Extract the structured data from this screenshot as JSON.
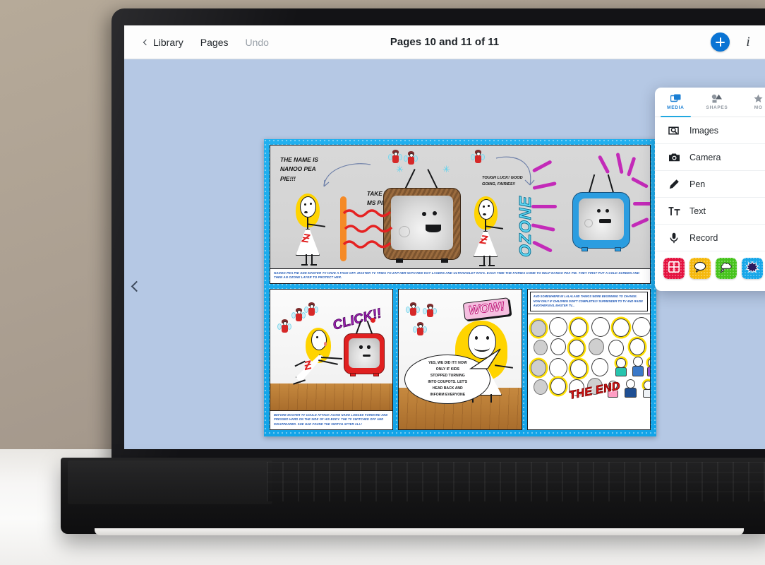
{
  "app": {
    "toolbar": {
      "back_label": "Library",
      "pages_label": "Pages",
      "undo_label": "Undo",
      "title": "Pages 10 and 11 of 11",
      "add_icon": "plus-icon",
      "info_icon": "info-icon"
    },
    "canvas": {
      "prev_page_icon": "chevron-left-icon",
      "background_color": "#b5c8e4"
    },
    "tool_panel": {
      "tabs": [
        {
          "label": "MEDIA",
          "icon": "media-icon",
          "active": true
        },
        {
          "label": "SHAPES",
          "icon": "shapes-icon",
          "active": false
        },
        {
          "label": "MO",
          "icon": "more-icon",
          "active": false
        }
      ],
      "items": [
        {
          "label": "Images",
          "icon": "image-search-icon"
        },
        {
          "label": "Camera",
          "icon": "camera-icon"
        },
        {
          "label": "Pen",
          "icon": "pen-icon"
        },
        {
          "label": "Text",
          "icon": "text-icon"
        },
        {
          "label": "Record",
          "icon": "microphone-icon"
        }
      ],
      "swatches": [
        {
          "name": "layout-grid-swatch",
          "color": "#e4123f",
          "icon": "grid-panels-icon"
        },
        {
          "name": "speech-bubble-swatch",
          "color": "#f5b80c",
          "icon": "speech-bubble-icon"
        },
        {
          "name": "thought-cloud-swatch",
          "color": "#46c31c",
          "icon": "thought-cloud-icon"
        },
        {
          "name": "burst-swatch",
          "color": "#16a6e8",
          "icon": "burst-pow-icon"
        }
      ]
    }
  },
  "comic": {
    "border_color": "#15a8ea",
    "panels": {
      "top": {
        "speech_1": "THE NAME IS\nNANOO PEA\nPIE!!!",
        "speech_2": "TAKE THAT,\nMS PIE!",
        "speech_3": "TOUGH LUCK! GOOD\nGOING, FAIRIES!!",
        "word_art": "OZONE",
        "caption": "NANOO PEA PIE AND MASTER TV HAVE A FACE OFF. MASTER TV TRIES TO ZAP HER WITH RED HOT LASERS AND ULTRAVIOLET RAYS. EACH TIME THE FAIRIES COME TO HELP NANOO PEA PIE. THEY FIRST PUT A COLD SCREEN AND THEN AN OZONE LAYER TO PROTECT HER."
      },
      "bottom_left": {
        "sound_effect": "CLICK!!",
        "caption": "BEFORE MASTER TV COULD ATTACK AGAIN NANO LUNGED FORWARD AND PRESSED HARD ON THE SIDE OF HIS BODY. THE TV SWITCHED OFF AND DISAPPEARED. SHE HAD FOUND THE SWITCH AFTER ALL!"
      },
      "bottom_middle": {
        "sound_effect": "WOW!",
        "speech": "YES, WE DID IT!! NOW\nONLY IF KIDS\nSTOPPED TURNING\nINTO COUPOTS. LET'S\nHEAD BACK AND\nINFORM EVERYONE"
      },
      "bottom_right": {
        "caption": "AND SOMEWHERE IN LALALAND THINGS WERE BEGINNING TO CHANGE. NOW ONLY IF CHILDREN DON'T COMPLETELY SURRENDER TO TV AND RAISE ANOTHER EVIL MASTER TV...",
        "sound_effect": "THE END"
      }
    }
  }
}
